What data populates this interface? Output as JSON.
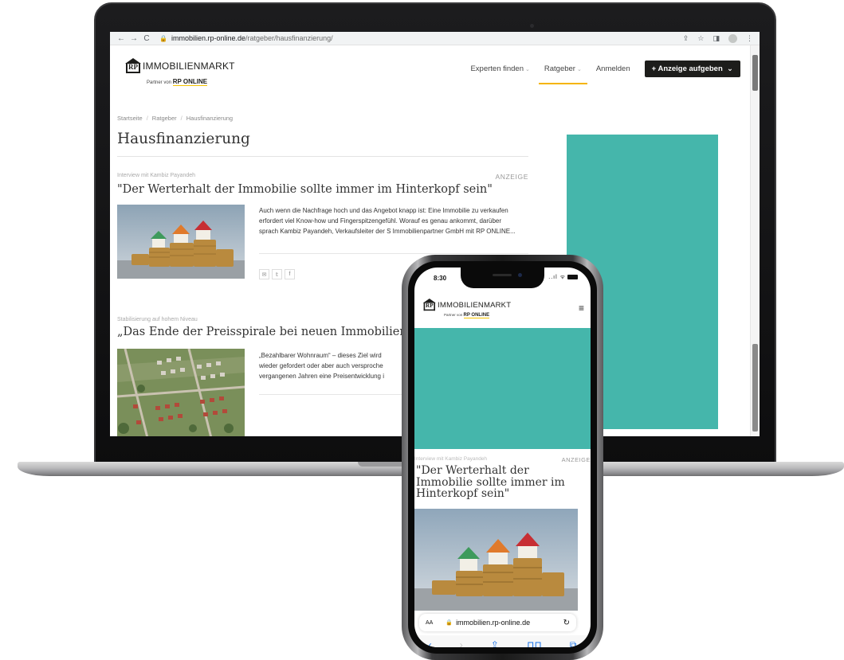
{
  "browser": {
    "url_host": "immobilien.rp-online.de",
    "url_path": "/ratgeber/hausfinanzierung/",
    "back_icon": "←",
    "forward_icon": "→",
    "reload_icon": "C",
    "lock_icon": "🔒",
    "share_icon": "⇪",
    "star_icon": "☆",
    "sidepanel_icon": "◨",
    "profile_icon": "●",
    "menu_icon": "⋮"
  },
  "site": {
    "logo_mark": "RP",
    "logo_text": "IMMOBILIENMARKT",
    "partner_prefix": "Partner von",
    "partner_brand": "RP ONLINE",
    "nav": [
      {
        "label": "Experten finden"
      },
      {
        "label": "Ratgeber"
      },
      {
        "label": "Anmelden"
      }
    ],
    "nav_chevron": "⌄",
    "cta_label": "+ Anzeige aufgeben",
    "cta_chevron": "⌄"
  },
  "breadcrumb": [
    "Startseite",
    "Ratgeber",
    "Hausfinanzierung"
  ],
  "breadcrumb_sep": "/",
  "page_title": "Hausfinanzierung",
  "articles": [
    {
      "kicker": "Interview mit Kambiz Payandeh",
      "ad_label": "ANZEIGE",
      "headline": "\"Der Werterhalt der Immobilie sollte immer im Hinterkopf sein\"",
      "teaser": "Auch wenn die Nachfrage hoch und das Angebot knapp ist: Eine Immobilie zu verkaufen erfordert viel Know-how und Fingerspitzengefühl. Worauf es genau ankommt, darüber sprach Kambiz Payandeh, Verkaufsleiter der S Immobilienpartner GmbH mit RP ONLINE...",
      "share_icons": [
        "✉",
        "𝕥",
        "f"
      ]
    },
    {
      "kicker": "Stabilisierung auf hohem Niveau",
      "headline": "„Das Ende der Preisspirale bei neuen Immobilien in Dü",
      "teaser_lines": [
        "„Bezahlbarer Wohnraum“ – dieses Ziel wird",
        "wieder gefordert oder aber auch versproche",
        "vergangenen Jahren eine Preisentwicklung i"
      ]
    }
  ],
  "phone": {
    "time": "8:30",
    "signal_icons": "..ıl ᯤ",
    "menu_icon": "≡",
    "kicker": "Interview mit Kambiz Payandeh",
    "ad_label": "ANZEIGE",
    "headline": "\"Der Werterhalt der Immobilie sollte immer im Hinterkopf sein\"",
    "url_text_size": "AA",
    "url": "immobilien.rp-online.de",
    "reload_icon": "↻",
    "toolbar": [
      "‹",
      "›",
      "⇪",
      "⊓⊓",
      "⧉"
    ]
  },
  "colors": {
    "ad_teal": "#45b6ab",
    "accent_yellow": "#f5b400",
    "cta_bg": "#1d1d1b"
  }
}
